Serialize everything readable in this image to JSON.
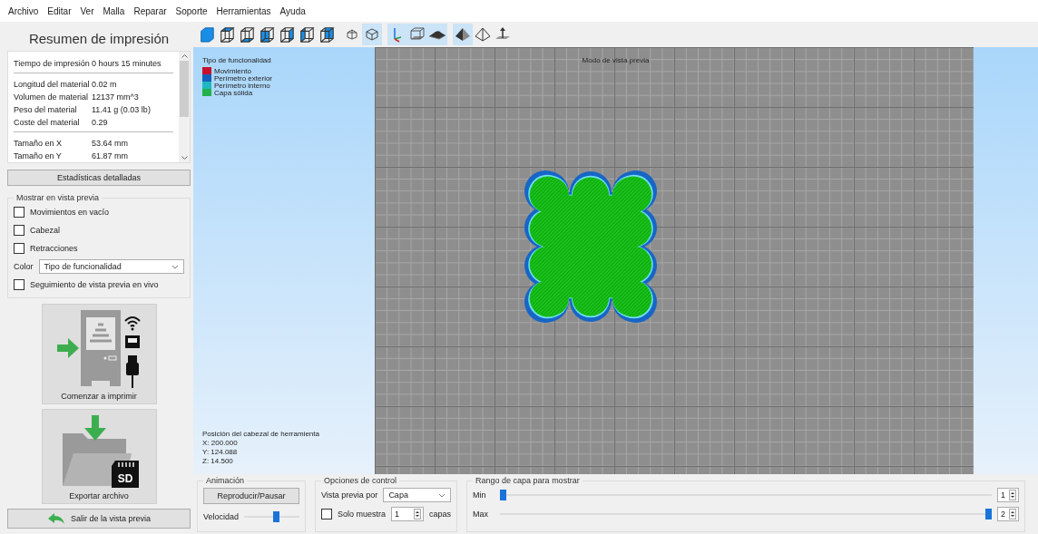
{
  "menu": [
    "Archivo",
    "Editar",
    "Ver",
    "Malla",
    "Reparar",
    "Soporte",
    "Herramientas",
    "Ayuda"
  ],
  "summary": {
    "title": "Resumen de impresión",
    "stat_groups": [
      [
        {
          "label": "Tiempo de impresión",
          "value": "0 hours 15 minutes"
        }
      ],
      [
        {
          "label": "Longitud del material",
          "value": "0.02 m"
        },
        {
          "label": "Volumen de material",
          "value": "12137 mm^3"
        },
        {
          "label": "Peso del material",
          "value": "11.41 g (0.03 lb)"
        },
        {
          "label": "Coste del material",
          "value": "0.29"
        }
      ],
      [
        {
          "label": "Tamaño en X",
          "value": "53.64 mm"
        },
        {
          "label": "Tamaño en Y",
          "value": "61.87 mm"
        }
      ]
    ],
    "details_button": "Estadísticas detalladas"
  },
  "preview_options": {
    "title": "Mostrar en vista previa",
    "items": [
      {
        "kind": "checkbox",
        "label": "Movimientos en vacío",
        "checked": false
      },
      {
        "kind": "checkbox",
        "label": "Cabezal",
        "checked": false
      },
      {
        "kind": "checkbox",
        "label": "Retracciones",
        "checked": false
      },
      {
        "kind": "select",
        "label": "Color",
        "value": "Tipo de funcionalidad"
      },
      {
        "kind": "checkbox",
        "label": "Seguimiento de vista previa en vivo",
        "checked": false
      }
    ]
  },
  "print_button": {
    "label": "Comenzar a imprimir"
  },
  "export_button": {
    "label": "Exportar archivo",
    "card_label": "SD"
  },
  "exit_button": "Salir de la vista previa",
  "toolbar": [
    [
      {
        "kind": "iso",
        "selected": false
      },
      {
        "kind": "top",
        "selected": false
      },
      {
        "kind": "bottom",
        "selected": false
      },
      {
        "kind": "front",
        "selected": false
      },
      {
        "kind": "right",
        "selected": false
      },
      {
        "kind": "left",
        "selected": false
      },
      {
        "kind": "back",
        "selected": false
      }
    ],
    [
      {
        "kind": "wire-small",
        "selected": false
      },
      {
        "kind": "wire-cube",
        "selected": true
      }
    ],
    [
      {
        "kind": "axes",
        "selected": true
      },
      {
        "kind": "box-outline",
        "selected": true
      },
      {
        "kind": "part",
        "selected": true
      }
    ],
    [
      {
        "kind": "pyramid-solid",
        "selected": true
      },
      {
        "kind": "pyramid-outline",
        "selected": false
      },
      {
        "kind": "ground",
        "selected": false
      }
    ]
  ],
  "viewport": {
    "legend": {
      "title": "Tipo de funcionalidad",
      "items": [
        {
          "label": "Movimiento",
          "color": "#c8102e"
        },
        {
          "label": "Perímetro exterior",
          "color": "#1560bd"
        },
        {
          "label": "Perímetro interno",
          "color": "#20b8c0"
        },
        {
          "label": "Capa sólida",
          "color": "#22b14c"
        }
      ]
    },
    "mode_label": "Modo de vista previa",
    "tool_position": {
      "title": "Posición del cabezal de herramienta",
      "lines": [
        "X: 200.000",
        "Y: 124.088",
        "Z: 14.500"
      ]
    }
  },
  "animation": {
    "title": "Animación",
    "button": "Reproducir/Pausar",
    "speed_label": "Velocidad",
    "speed": {
      "level": 0.6
    }
  },
  "control": {
    "title": "Opciones de control",
    "preview_by_label": "Vista previa por",
    "preview_by": "Capa",
    "only_show": {
      "label": "Solo muestra",
      "checked": false,
      "value": "1",
      "unit": "capas"
    }
  },
  "layer_range": {
    "title": "Rango de capa para mostrar",
    "min": {
      "label": "Min",
      "level": 0,
      "value": "1"
    },
    "max": {
      "label": "Max",
      "level": 1,
      "value": "2"
    }
  }
}
